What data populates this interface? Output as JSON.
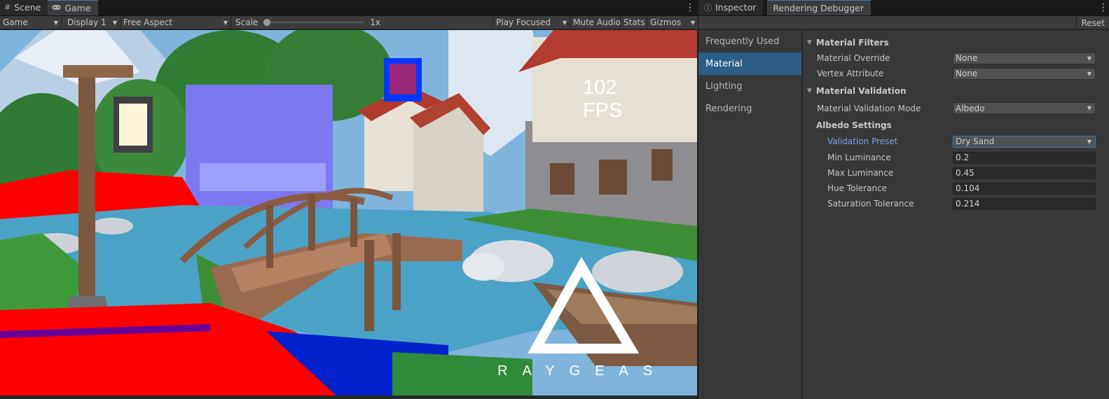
{
  "game_window": {
    "tabs": [
      {
        "label": "Scene",
        "icon": "grid-icon"
      },
      {
        "label": "Game",
        "icon": "gamepad-icon"
      }
    ],
    "toolbar": {
      "game_select": "Game",
      "display_select": "Display 1",
      "aspect_select": "Free Aspect",
      "scale_label": "Scale",
      "scale_value": "1x",
      "scale_fraction": 0,
      "play_mode_select": "Play Focused",
      "mute_audio": "Mute Audio",
      "stats": "Stats",
      "gizmos": "Gizmos"
    },
    "view": {
      "fps_value": "102",
      "fps_unit": "FPS",
      "logo_text": "RAYGEAS"
    }
  },
  "debugger_window": {
    "tabs": [
      {
        "label": "Inspector",
        "icon": "info-icon"
      },
      {
        "label": "Rendering Debugger"
      }
    ],
    "reset_label": "Reset",
    "sidebar": [
      "Frequently Used",
      "Material",
      "Lighting",
      "Rendering"
    ],
    "selected_sidebar": "Material",
    "sections": {
      "filters": {
        "title": "Material Filters",
        "material_override": {
          "label": "Material Override",
          "value": "None"
        },
        "vertex_attribute": {
          "label": "Vertex Attribute",
          "value": "None"
        }
      },
      "validation": {
        "title": "Material Validation",
        "mode": {
          "label": "Material Validation Mode",
          "value": "Albedo"
        },
        "albedo_title": "Albedo Settings",
        "preset": {
          "label": "Validation Preset",
          "value": "Dry Sand"
        },
        "min_luminance": {
          "label": "Min Luminance",
          "value": "0.2"
        },
        "max_luminance": {
          "label": "Max Luminance",
          "value": "0.45"
        },
        "hue_tolerance": {
          "label": "Hue Tolerance",
          "value": "0.104"
        },
        "saturation_tolerance": {
          "label": "Saturation Tolerance",
          "value": "0.214"
        }
      }
    }
  },
  "colors": {
    "accent": "#3a79bb",
    "selected_item": "#2c5d87",
    "highlight_label": "#7ca6e6",
    "validation_red": "#ff0000",
    "validation_blue": "#0000ff"
  }
}
